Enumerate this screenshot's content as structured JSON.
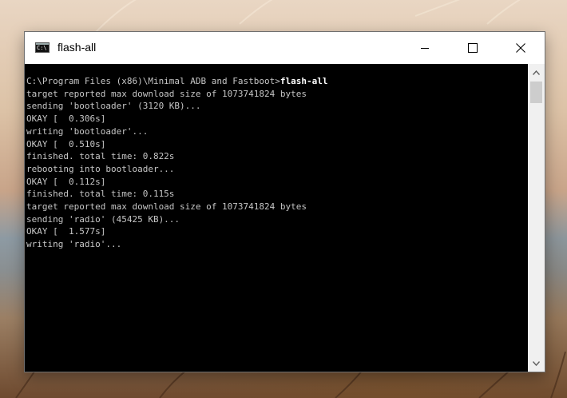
{
  "window": {
    "title": "flash-all",
    "icon_label": "C:\\",
    "icon": "cmd-icon"
  },
  "controls": {
    "minimize": "minimize-icon",
    "maximize": "maximize-icon",
    "close": "close-icon"
  },
  "console": {
    "prompt": "C:\\Program Files (x86)\\Minimal ADB and Fastboot>",
    "command": "flash-all",
    "output": [
      "target reported max download size of 1073741824 bytes",
      "sending 'bootloader' (3120 KB)...",
      "OKAY [  0.306s]",
      "writing 'bootloader'...",
      "OKAY [  0.510s]",
      "finished. total time: 0.822s",
      "rebooting into bootloader...",
      "OKAY [  0.112s]",
      "finished. total time: 0.115s",
      "target reported max download size of 1073741824 bytes",
      "sending 'radio' (45425 KB)...",
      "OKAY [  1.577s]",
      "writing 'radio'..."
    ]
  },
  "scrollbar": {
    "up": "chevron-up-icon",
    "down": "chevron-down-icon"
  }
}
